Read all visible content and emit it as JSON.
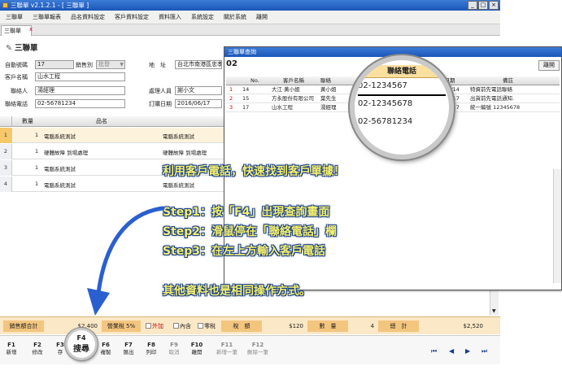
{
  "window": {
    "title": "三聯單 v2.1.2.1 - [ 三聯單 ]",
    "min": "_",
    "max": "□",
    "close": "×"
  },
  "menu": [
    "三聯單",
    "三聯單報表",
    "品名資料設定",
    "客戶資料設定",
    "資料匯入",
    "系統設定",
    "關於系統",
    "離開"
  ],
  "tab": {
    "label": "三聯單",
    "close": "x"
  },
  "form": {
    "heading": "三聯單",
    "auto_no_label": "自動號碼",
    "auto_no": "17",
    "sales_label": "銷售別",
    "sales": "批發",
    "address_label": "地　址",
    "address": "台北市南港區忠孝",
    "customer_label": "客戶名稱",
    "customer": "山水工程",
    "contact_label": "聯絡人",
    "contact": "湯經理",
    "handler_label": "處理人員",
    "handler": "謝小文",
    "phone_label": "聯絡電話",
    "phone": "02-56781234",
    "order_date_label": "訂購日期",
    "order_date": "2016/06/17"
  },
  "grid": {
    "qty_header": "數量",
    "name_header": "品名",
    "rows": [
      {
        "no": "1",
        "qty": "1",
        "name": "電腦系統測試",
        "name2": "電腦系統測試"
      },
      {
        "no": "2",
        "qty": "1",
        "name": "硬體故障 到場處理",
        "name2": "硬體故障 到場處理"
      },
      {
        "no": "3",
        "qty": "1",
        "name": "電腦系統測試",
        "name2": "電腦系統測試"
      },
      {
        "no": "4",
        "qty": "1",
        "name": "電腦系統測試",
        "name2": "電腦系統測試"
      }
    ]
  },
  "totals": {
    "sales_total_label": "銷售額合計",
    "sales_total": "$2,400",
    "tax_label": "營業稅 5%",
    "opt_extra": "外加",
    "opt_included": "內含",
    "opt_zero": "零稅",
    "tax_amount_label": "稅　額",
    "tax_amount": "$120",
    "qty_label": "數　量",
    "qty": "4",
    "total_label": "總　計",
    "total": "$2,520"
  },
  "fkeys": [
    {
      "key": "F1",
      "label": "新增"
    },
    {
      "key": "F2",
      "label": "修改"
    },
    {
      "key": "F3",
      "label": "存"
    },
    {
      "key": "F4",
      "label": "搜尋"
    },
    {
      "key": "F6",
      "label": "複製"
    },
    {
      "key": "F7",
      "label": "匯出"
    },
    {
      "key": "F8",
      "label": "列印"
    },
    {
      "key": "F9",
      "label": "取消"
    },
    {
      "key": "F10",
      "label": "離開"
    },
    {
      "key": "F11",
      "label": "新增一筆"
    },
    {
      "key": "F12",
      "label": "刪除一筆"
    }
  ],
  "nav": [
    "⏮",
    "◀",
    "▶",
    "⏭"
  ],
  "dialog": {
    "title": "三聯單查詢",
    "search": "02",
    "leave": "離開",
    "headers": [
      "No.",
      "客戶名稱",
      "聯絡",
      "",
      "聯絡電話",
      "購日期",
      "備註"
    ],
    "rows": [
      {
        "sel": "1",
        "no": "14",
        "name": "大江 黃小姐",
        "contact": "黃小姐",
        "phone": "02-1234567",
        "date": "/06/14",
        "note": "特資前先電話聯絡"
      },
      {
        "sel": "2",
        "no": "15",
        "name": "方永股份有限公司",
        "contact": "葉先生",
        "phone": "02-12345678",
        "date": "/06/17",
        "note": "出貨前先電話通知."
      },
      {
        "sel": "3",
        "no": "17",
        "name": "山水工程",
        "contact": "湯經理",
        "phone": "02-56781234",
        "date": "/06/17",
        "note": "統一編號 12345678"
      }
    ]
  },
  "magnifier": {
    "header": "聯絡電話",
    "phones": [
      "02-1234567",
      "02-12345678",
      "02-56781234"
    ]
  },
  "callouts": {
    "line1": "利用客戶電話，快速找到客戶單據！",
    "step1": "Step1：按「F4」出現查詢畫面",
    "step2": "Step2：滑鼠停在「聯絡電話」欄",
    "step3": "Step3：在左上方輸入客戶電話",
    "line5": "其他資料也是相同操作方式。"
  },
  "colors": {
    "titlebar": "#1b56b8",
    "callout_text": "#f5f06a",
    "arrow": "#2a5fd0"
  }
}
